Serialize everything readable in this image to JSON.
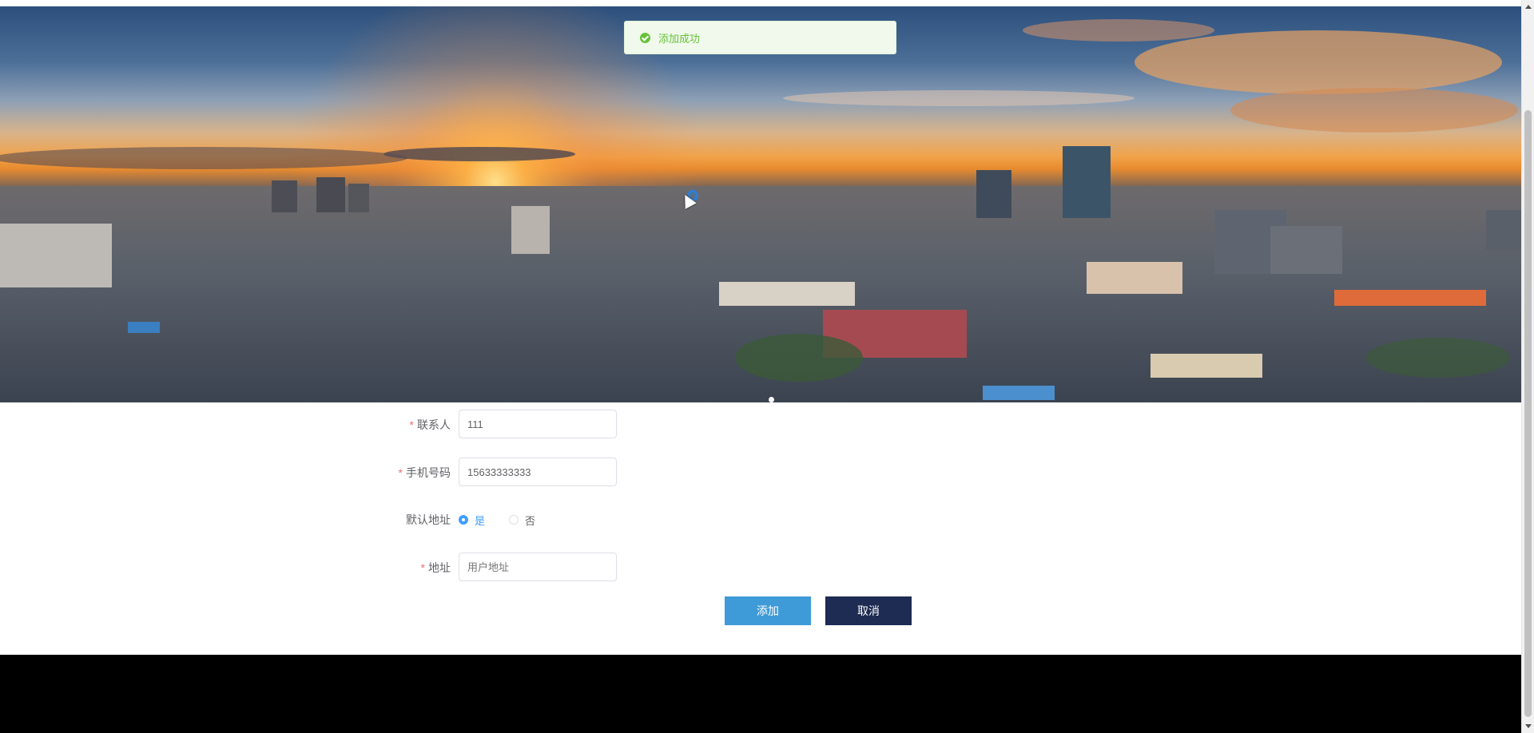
{
  "toast": {
    "message": "添加成功",
    "icon": "check-circle-icon",
    "color": "#67c23a"
  },
  "banner": {
    "image": "city-sunset-skyline",
    "carousel_dots": 1
  },
  "form": {
    "contact": {
      "label": "联系人",
      "required": true,
      "value": "111"
    },
    "phone": {
      "label": "手机号码",
      "required": true,
      "value": "15633333333"
    },
    "default_address": {
      "label": "默认地址",
      "options": [
        "是",
        "否"
      ],
      "selected": "是"
    },
    "address": {
      "label": "地址",
      "required": true,
      "value": "",
      "placeholder": "用户地址"
    }
  },
  "buttons": {
    "add": "添加",
    "cancel": "取消"
  },
  "colors": {
    "add_button": "#3e9bd8",
    "cancel_button": "#1e2b52",
    "required_star": "#f56c6c",
    "radio_active": "#409eff",
    "footer": "#000000"
  }
}
